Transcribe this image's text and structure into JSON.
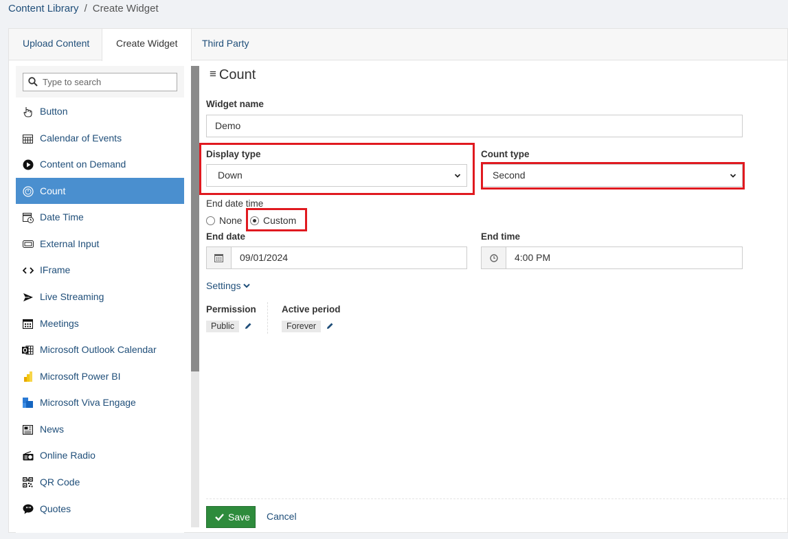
{
  "breadcrumb": {
    "parent": "Content Library",
    "separator": "/",
    "current": "Create Widget"
  },
  "tabs": [
    {
      "label": "Upload Content"
    },
    {
      "label": "Create Widget"
    },
    {
      "label": "Third Party"
    }
  ],
  "sidebar": {
    "search_placeholder": "Type to search",
    "items": [
      {
        "label": "Button",
        "icon": "hand-pointer-icon"
      },
      {
        "label": "Calendar of Events",
        "icon": "calendar-grid-icon"
      },
      {
        "label": "Content on Demand",
        "icon": "play-circle-icon"
      },
      {
        "label": "Count",
        "icon": "count-circle-icon",
        "active": true
      },
      {
        "label": "Date Time",
        "icon": "calendar-clock-icon"
      },
      {
        "label": "External Input",
        "icon": "keyboard-icon"
      },
      {
        "label": "IFrame",
        "icon": "code-icon"
      },
      {
        "label": "Live Streaming",
        "icon": "send-icon"
      },
      {
        "label": "Meetings",
        "icon": "calendar-icon"
      },
      {
        "label": "Microsoft Outlook Calendar",
        "icon": "outlook-icon"
      },
      {
        "label": "Microsoft Power BI",
        "icon": "power-bi-icon"
      },
      {
        "label": "Microsoft Viva Engage",
        "icon": "viva-engage-icon"
      },
      {
        "label": "News",
        "icon": "newspaper-icon"
      },
      {
        "label": "Online Radio",
        "icon": "radio-icon"
      },
      {
        "label": "QR Code",
        "icon": "qr-code-icon"
      },
      {
        "label": "Quotes",
        "icon": "quote-bubble-icon"
      }
    ]
  },
  "panel": {
    "title": "Count",
    "widget_name_label": "Widget name",
    "widget_name_value": "Demo",
    "display_type_label": "Display type",
    "display_type_value": "Down",
    "count_type_label": "Count type",
    "count_type_value": "Second",
    "end_datetime_label": "End date time",
    "radio_none": "None",
    "radio_custom": "Custom",
    "end_date_label": "End date",
    "end_date_value": "09/01/2024",
    "end_time_label": "End time",
    "end_time_value": "4:00 PM",
    "settings_label": "Settings",
    "permission_label": "Permission",
    "permission_value": "Public",
    "active_period_label": "Active period",
    "active_period_value": "Forever",
    "save_label": "Save",
    "cancel_label": "Cancel"
  },
  "colors": {
    "link": "#1f4e79",
    "active_nav": "#4a8fcf",
    "save_button": "#2e8b3c",
    "highlight": "#e0191f"
  }
}
